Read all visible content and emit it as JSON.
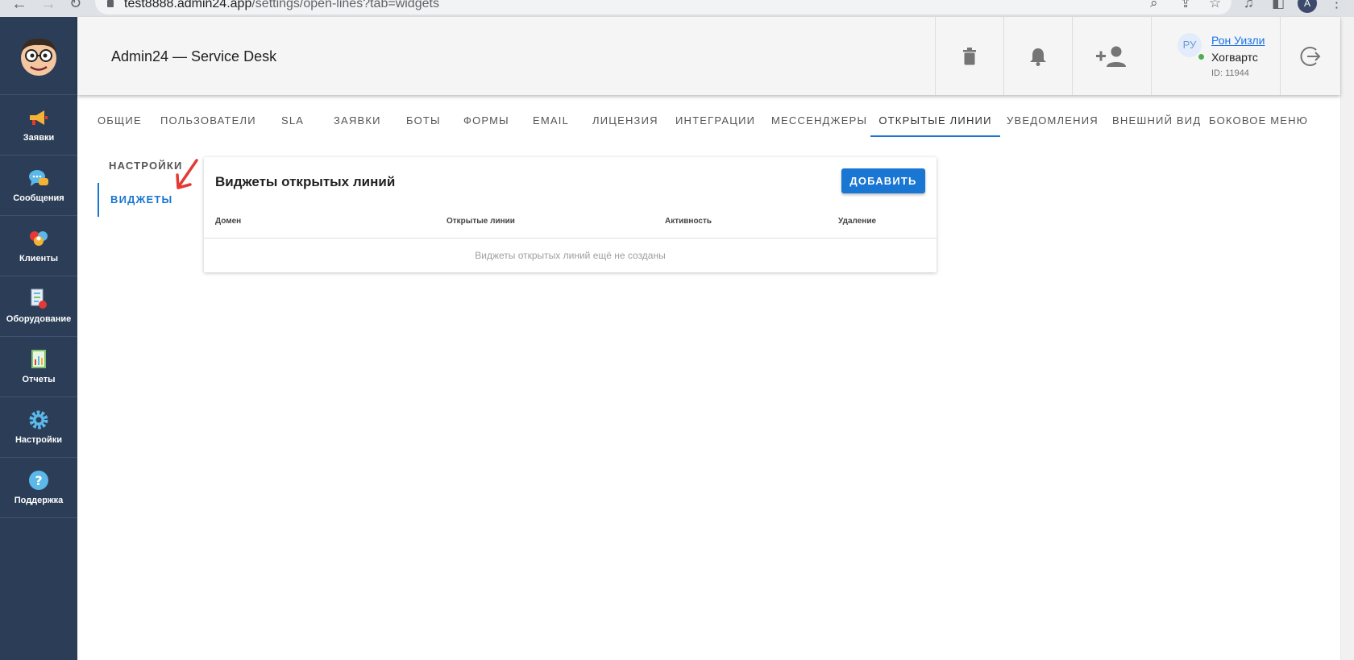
{
  "browser": {
    "url_host": "test8888.admin24.app",
    "url_path": "/settings/open-lines?tab=widgets",
    "profile_initial": "A"
  },
  "sidebar": {
    "items": [
      {
        "label": "Заявки",
        "icon": "megaphone-icon"
      },
      {
        "label": "Сообщения",
        "icon": "chat-bubble-icon"
      },
      {
        "label": "Клиенты",
        "icon": "clients-icon"
      },
      {
        "label": "Оборудование",
        "icon": "equipment-icon"
      },
      {
        "label": "Отчеты",
        "icon": "report-icon"
      },
      {
        "label": "Настройки",
        "icon": "gear-icon"
      },
      {
        "label": "Поддержка",
        "icon": "help-icon"
      }
    ]
  },
  "header": {
    "title": "Admin24 — Service Desk",
    "user": {
      "avatar_text": "РУ",
      "name": "Рон Уизли",
      "org": "Хогвартс",
      "id": "ID: 11944"
    }
  },
  "tabs": [
    {
      "label": "ОБЩИЕ"
    },
    {
      "label": "ПОЛЬЗОВАТЕЛИ"
    },
    {
      "label": "SLA"
    },
    {
      "label": "ЗАЯВКИ"
    },
    {
      "label": "БОТЫ"
    },
    {
      "label": "ФОРМЫ"
    },
    {
      "label": "EMAIL"
    },
    {
      "label": "ЛИЦЕНЗИЯ"
    },
    {
      "label": "ИНТЕГРАЦИИ"
    },
    {
      "label": "МЕССЕНДЖЕРЫ"
    },
    {
      "label": "ОТКРЫТЫЕ ЛИНИИ",
      "active": true
    },
    {
      "label": "УВЕДОМЛЕНИЯ"
    },
    {
      "label": "ВНЕШНИЙ ВИД"
    },
    {
      "label": "БОКОВОЕ МЕНЮ"
    }
  ],
  "subnav": {
    "settings": "НАСТРОЙКИ",
    "widgets": "ВИДЖЕТЫ"
  },
  "card": {
    "title": "Виджеты открытых линий",
    "add_label": "ДОБАВИТЬ",
    "columns": [
      "Домен",
      "Открытые линии",
      "Активность",
      "Удаление"
    ],
    "empty": "Виджеты открытых линий ещё не созданы"
  },
  "colors": {
    "sidebar_bg": "#2c3e57",
    "accent": "#1976d2",
    "header_bg": "#f5f5f5",
    "online": "#4caf50",
    "annotation": "#e53935"
  }
}
